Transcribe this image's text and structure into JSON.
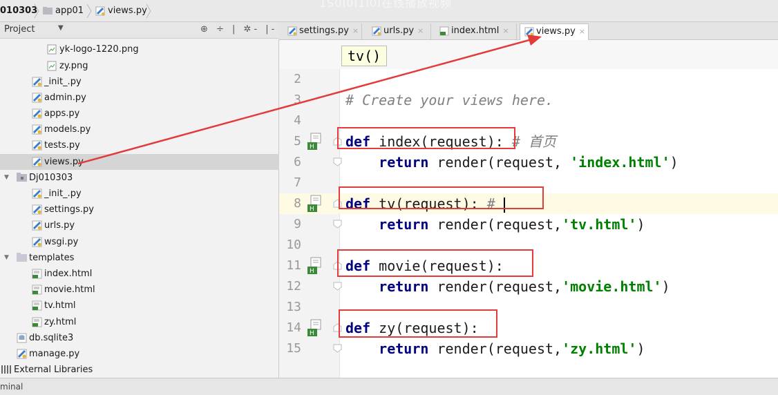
{
  "breadcrumb": {
    "items": [
      "010303",
      "app01",
      "views.py"
    ]
  },
  "watermark": "1S0I0I1I0I在线播放视频",
  "project_panel": {
    "title": "Project",
    "tools": "⊕ ÷ | ✲- |-"
  },
  "tree": [
    {
      "label": "yk-logo-1220.png",
      "type": "image"
    },
    {
      "label": "zy.png",
      "type": "image"
    },
    {
      "label": "_init_.py",
      "type": "python"
    },
    {
      "label": "admin.py",
      "type": "python"
    },
    {
      "label": "apps.py",
      "type": "python"
    },
    {
      "label": "models.py",
      "type": "python"
    },
    {
      "label": "tests.py",
      "type": "python"
    },
    {
      "label": "views.py",
      "type": "python",
      "selected": true
    },
    {
      "label": "Dj010303",
      "type": "package"
    },
    {
      "label": "_init_.py",
      "type": "python"
    },
    {
      "label": "settings.py",
      "type": "python"
    },
    {
      "label": "urls.py",
      "type": "python"
    },
    {
      "label": "wsgi.py",
      "type": "python"
    },
    {
      "label": "templates",
      "type": "folder"
    },
    {
      "label": "index.html",
      "type": "html"
    },
    {
      "label": "movie.html",
      "type": "html"
    },
    {
      "label": "tv.html",
      "type": "html"
    },
    {
      "label": "zy.html",
      "type": "html"
    },
    {
      "label": "db.sqlite3",
      "type": "db"
    },
    {
      "label": "manage.py",
      "type": "python"
    },
    {
      "label": "External Libraries",
      "type": "libs"
    }
  ],
  "tabs": [
    {
      "label": "settings.py",
      "close": "×"
    },
    {
      "label": "urls.py",
      "close": "×"
    },
    {
      "label": "index.html",
      "close": "×"
    },
    {
      "label": "views.py",
      "close": "×",
      "active": true
    }
  ],
  "editor": {
    "hint": "tv()",
    "lines": [
      {
        "num": "2",
        "tokens": []
      },
      {
        "num": "3",
        "tokens": [
          {
            "t": "# Create your views here.",
            "c": "cm"
          }
        ]
      },
      {
        "num": "4",
        "tokens": []
      },
      {
        "num": "5",
        "tokens": [
          {
            "t": "def",
            "c": "kw"
          },
          {
            "t": " index(request): "
          },
          {
            "t": "# 首页",
            "c": "cm"
          }
        ]
      },
      {
        "num": "6",
        "tokens": [
          {
            "t": "    "
          },
          {
            "t": "return",
            "c": "kw"
          },
          {
            "t": " render(request, "
          },
          {
            "t": "'index.html'",
            "c": "str"
          },
          {
            "t": ")"
          }
        ]
      },
      {
        "num": "7",
        "tokens": []
      },
      {
        "num": "8",
        "tokens": [
          {
            "t": "def",
            "c": "kw"
          },
          {
            "t": " tv(request): "
          },
          {
            "t": "# ",
            "c": "cm"
          }
        ],
        "current": true
      },
      {
        "num": "9",
        "tokens": [
          {
            "t": "    "
          },
          {
            "t": "return",
            "c": "kw"
          },
          {
            "t": " render(request,"
          },
          {
            "t": "'tv.html'",
            "c": "str"
          },
          {
            "t": ")"
          }
        ]
      },
      {
        "num": "10",
        "tokens": []
      },
      {
        "num": "11",
        "tokens": [
          {
            "t": "def",
            "c": "kw"
          },
          {
            "t": " movie(request):"
          }
        ]
      },
      {
        "num": "12",
        "tokens": [
          {
            "t": "    "
          },
          {
            "t": "return",
            "c": "kw"
          },
          {
            "t": " render(request,"
          },
          {
            "t": "'movie.html'",
            "c": "str"
          },
          {
            "t": ")"
          }
        ]
      },
      {
        "num": "13",
        "tokens": []
      },
      {
        "num": "14",
        "tokens": [
          {
            "t": "def",
            "c": "kw"
          },
          {
            "t": " zy(request):"
          }
        ]
      },
      {
        "num": "15",
        "tokens": [
          {
            "t": "    "
          },
          {
            "t": "return",
            "c": "kw"
          },
          {
            "t": " render(request,"
          },
          {
            "t": "'zy.html'",
            "c": "str"
          },
          {
            "t": ")"
          }
        ]
      }
    ]
  },
  "bottom": {
    "label": "minal"
  },
  "colors": {
    "annotation_red": "#e23b3b",
    "keyword": "#000080",
    "string": "#008000",
    "comment": "#808080"
  }
}
